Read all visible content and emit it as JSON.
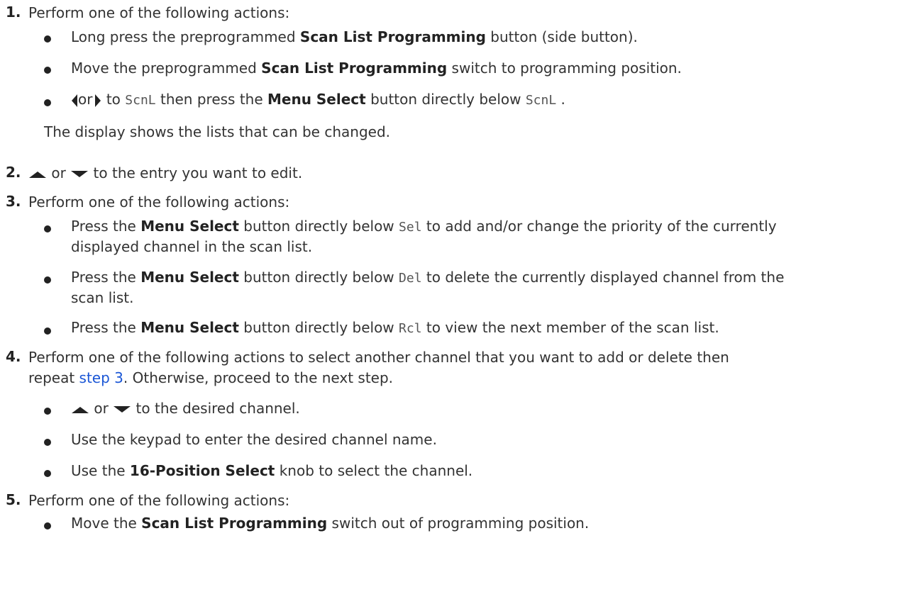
{
  "steps": {
    "s1": {
      "num": "1.",
      "text": "Perform one of the following actions:",
      "b1": {
        "pre": "Long press the preprogrammed ",
        "bold": "Scan List Programming",
        "post": " button (side button)."
      },
      "b2": {
        "pre": "Move the preprogrammed ",
        "bold": "Scan List Programming",
        "post": " switch to programming position."
      },
      "b3": {
        "or": "or",
        "to": " to ",
        "code1": "ScnL",
        "mid": " then press the ",
        "bold": "Menu Select",
        "mid2": " button directly below ",
        "code2": "ScnL",
        "post": " ."
      },
      "result": "The display shows the lists that can be changed."
    },
    "s2": {
      "num": "2.",
      "or": " or ",
      "post": " to the entry you want to edit."
    },
    "s3": {
      "num": "3.",
      "text": "Perform one of the following actions:",
      "b1": {
        "pre": "Press the ",
        "bold": "Menu Select",
        "mid": " button directly below ",
        "code": "Sel",
        "post1": " to add and/or change the priority of the currently",
        "post2": "displayed channel in the scan list."
      },
      "b2": {
        "pre": "Press the ",
        "bold": "Menu Select",
        "mid": " button directly below ",
        "code": "Del",
        "post1": " to delete the currently displayed channel from the",
        "post2": "scan list."
      },
      "b3": {
        "pre": "Press the ",
        "bold": "Menu Select",
        "mid": " button directly below ",
        "code": "Rcl",
        "post": " to view the next member of the scan list."
      }
    },
    "s4": {
      "num": "4.",
      "line1": "Perform one of the following actions to select another channel that you want to add or delete then",
      "pre2": "repeat ",
      "link": "step 3",
      "post2": ". Otherwise, proceed to the next step.",
      "b1": {
        "or": " or ",
        "post": " to the desired channel."
      },
      "b2": "Use the keypad to enter the desired channel name.",
      "b3": {
        "pre": "Use the ",
        "bold": "16-Position Select",
        "post": " knob to select the channel."
      }
    },
    "s5": {
      "num": "5.",
      "text": "Perform one of the following actions:",
      "b1": {
        "pre": "Move the ",
        "bold": "Scan List Programming",
        "post": " switch out of programming position."
      }
    }
  },
  "icons": {
    "up": "up-arrow-icon",
    "down": "down-arrow-icon",
    "left": "left-arrow-icon",
    "right": "right-arrow-icon",
    "bullet": "bullet-icon"
  },
  "colors": {
    "text": "#333333",
    "link": "#1a56d6"
  }
}
